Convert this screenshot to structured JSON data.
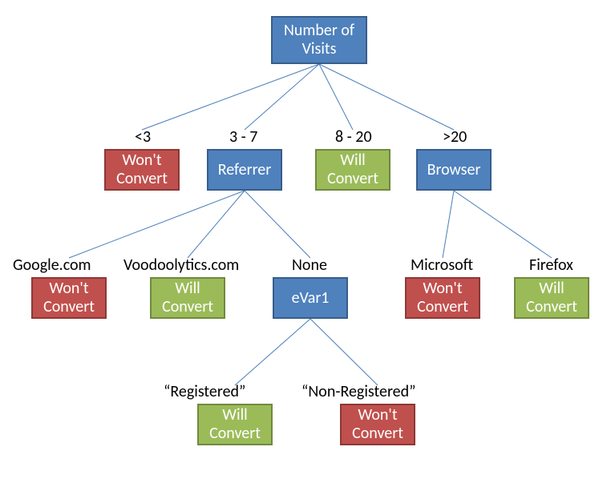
{
  "root": {
    "text": "Number of\nVisits"
  },
  "level1": {
    "lt3": {
      "label": "<3",
      "box_text": "Won't\nConvert"
    },
    "r37": {
      "label": "3 - 7",
      "box_text": "Referrer"
    },
    "r820": {
      "label": "8 - 20",
      "box_text": "Will\nConvert"
    },
    "gt20": {
      "label": ">20",
      "box_text": "Browser"
    }
  },
  "referrer_children": {
    "google": {
      "label": "Google.com",
      "box_text": "Won't\nConvert"
    },
    "voodoo": {
      "label": "Voodoolytics.com",
      "box_text": "Will\nConvert"
    },
    "none": {
      "label": "None",
      "box_text": "eVar1"
    }
  },
  "browser_children": {
    "microsoft": {
      "label": "Microsoft",
      "box_text": "Won't\nConvert"
    },
    "firefox": {
      "label": "Firefox",
      "box_text": "Will\nConvert"
    }
  },
  "evar1_children": {
    "registered": {
      "label": "“Registered”",
      "box_text": "Will\nConvert"
    },
    "non_registered": {
      "label": "“Non-Registered”",
      "box_text": "Won't\nConvert"
    }
  },
  "colors": {
    "blue": "#4F81BD",
    "red": "#C0504D",
    "green": "#9BBB59",
    "line": "#4A7EBB"
  }
}
